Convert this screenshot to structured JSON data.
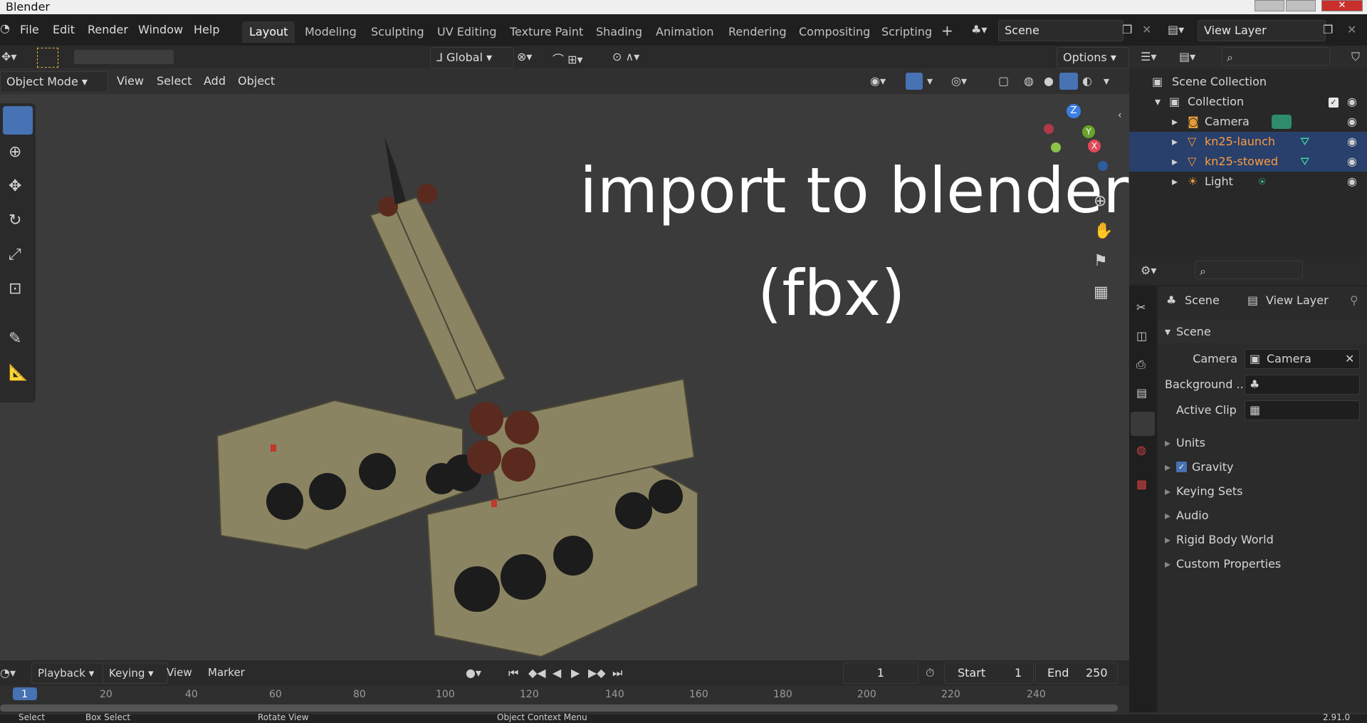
{
  "window": {
    "title": "Blender"
  },
  "menubar": {
    "items": [
      "File",
      "Edit",
      "Render",
      "Window",
      "Help"
    ]
  },
  "workspaces": {
    "tabs": [
      "Layout",
      "Modeling",
      "Sculpting",
      "UV Editing",
      "Texture Paint",
      "Shading",
      "Animation",
      "Rendering",
      "Compositing",
      "Scripting"
    ],
    "active": "Layout"
  },
  "scene_field": {
    "value": "Scene"
  },
  "view_layer_field": {
    "value": "View Layer"
  },
  "tool_header": {
    "transform_orientation": "Global",
    "options_label": "Options"
  },
  "viewport_header": {
    "mode": "Object Mode",
    "menus": [
      "View",
      "Select",
      "Add",
      "Object"
    ]
  },
  "viewport_overlay_text": {
    "line1": "import to blender",
    "line2": "(fbx)"
  },
  "gizmo_axes": {
    "z": "Z",
    "y": "Y",
    "x": "X"
  },
  "outliner": {
    "items": [
      {
        "label": "Scene Collection",
        "icon": "collection-icon",
        "color": "#d6d6d6"
      },
      {
        "label": "Collection",
        "icon": "collection-icon",
        "color": "#d6d6d6"
      },
      {
        "label": "Camera",
        "icon": "camera-icon",
        "color": "#d6d6d6"
      },
      {
        "label": "kn25-launch",
        "icon": "mesh-icon",
        "color": "#ff9a3c"
      },
      {
        "label": "kn25-stowed",
        "icon": "mesh-icon",
        "color": "#ff9a3c"
      },
      {
        "label": "Light",
        "icon": "light-icon",
        "color": "#d6d6d6"
      }
    ]
  },
  "properties": {
    "breadcrumb": {
      "scene": "Scene",
      "view_layer": "View Layer"
    },
    "panel_title": "Scene",
    "fields": [
      {
        "label": "Camera",
        "value": "Camera"
      },
      {
        "label": "Background ...",
        "value": ""
      },
      {
        "label": "Active Clip",
        "value": ""
      }
    ],
    "subpanels": [
      "Units",
      "Gravity",
      "Keying Sets",
      "Audio",
      "Rigid Body World",
      "Custom Properties"
    ],
    "gravity_enabled": true
  },
  "timeline": {
    "menus": [
      "Playback",
      "Keying",
      "View",
      "Marker"
    ],
    "current_frame": "1",
    "start_label": "Start",
    "start_value": "1",
    "end_label": "End",
    "end_value": "250",
    "ruler_ticks": [
      "1",
      "20",
      "40",
      "60",
      "80",
      "100",
      "120",
      "140",
      "160",
      "180",
      "200",
      "220",
      "240"
    ]
  },
  "statusbar": {
    "items": [
      "Select",
      "Box Select",
      "Rotate View",
      "Object Context Menu"
    ],
    "version": "2.91.0"
  },
  "colors": {
    "accent": "#4772b3",
    "selected_row": "#28406b",
    "object_orange": "#ff9a3c"
  }
}
